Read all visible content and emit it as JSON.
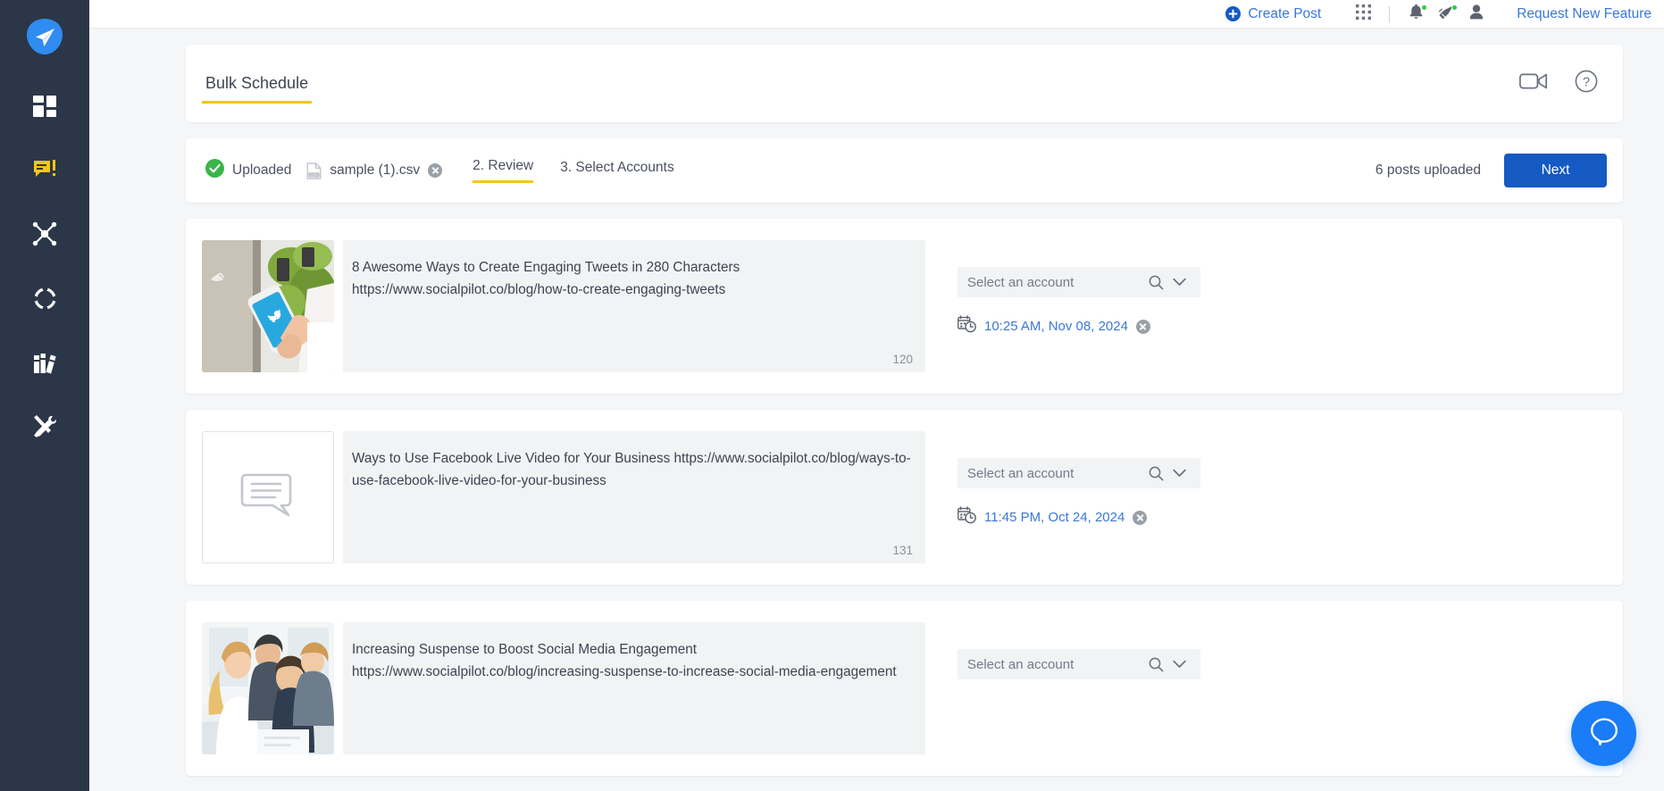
{
  "sidebar": {
    "logo_icon": "paper-plane-logo",
    "items": [
      {
        "icon": "dashboard-icon",
        "name": "dashboard"
      },
      {
        "icon": "content-icon",
        "name": "content"
      },
      {
        "icon": "network-icon",
        "name": "accounts"
      },
      {
        "icon": "target-icon",
        "name": "discovery"
      },
      {
        "icon": "books-icon",
        "name": "library"
      },
      {
        "icon": "tools-icon",
        "name": "tools"
      }
    ]
  },
  "header": {
    "create_post_label": "Create Post",
    "create_post_icon": "plus-circle-icon",
    "apps_icon": "apps-grid-icon",
    "bell_icon": "bell-icon",
    "announce_icon": "megaphone-icon",
    "user_icon": "user-avatar-icon",
    "request_feature_label": "Request New Feature",
    "link_color": "#3b78d8",
    "badge_color": "#2ecc40"
  },
  "title_card": {
    "tab_label": "Bulk Schedule",
    "underline_color": "#f5c518",
    "video_icon": "video-camera-icon",
    "help_icon": "help-circle-icon"
  },
  "steps": {
    "uploaded_label": "Uploaded",
    "uploaded_check_icon": "check-circle-icon",
    "check_color": "#3ab54a",
    "file_icon": "csv-file-icon",
    "file_name": "sample (1).csv",
    "remove_file_icon": "close-circle-icon",
    "step_review": "2. Review",
    "step_accounts": "3. Select Accounts",
    "active_step": "2. Review",
    "posts_uploaded": "6  posts uploaded",
    "next_label": "Next",
    "next_color": "#1559c2"
  },
  "posts": [
    {
      "thumb_type": "image-photo-phone-twitter",
      "text": "8 Awesome Ways to Create Engaging Tweets in 280 Characters https://www.socialpilot.co/blog/how-to-create-engaging-tweets",
      "char_count": "120",
      "account_placeholder": "Select an account",
      "search_icon": "search-icon",
      "chevron_icon": "chevron-down-icon",
      "schedule_icon": "calendar-clock-icon",
      "schedule_datetime": "10:25 AM, Nov 08, 2024",
      "remove_schedule_icon": "close-circle-icon"
    },
    {
      "thumb_type": "placeholder-speech-bubble",
      "text": "Ways to Use Facebook Live Video for Your Business https://www.socialpilot.co/blog/ways-to-use-facebook-live-video-for-your-business",
      "char_count": "131",
      "account_placeholder": "Select an account",
      "search_icon": "search-icon",
      "chevron_icon": "chevron-down-icon",
      "schedule_icon": "calendar-clock-icon",
      "schedule_datetime": "11:45 PM, Oct 24, 2024",
      "remove_schedule_icon": "close-circle-icon"
    },
    {
      "thumb_type": "image-photo-team-office",
      "text": "Increasing Suspense to Boost Social Media Engagement https://www.socialpilot.co/blog/increasing-suspense-to-increase-social-media-engagement",
      "char_count": "",
      "account_placeholder": "Select an account",
      "search_icon": "search-icon",
      "chevron_icon": "chevron-down-icon",
      "schedule_icon": "calendar-clock-icon",
      "schedule_datetime": "",
      "remove_schedule_icon": "close-circle-icon"
    }
  ],
  "chat_widget": {
    "icon": "chat-bubble-icon",
    "color": "#1a7cf7"
  }
}
